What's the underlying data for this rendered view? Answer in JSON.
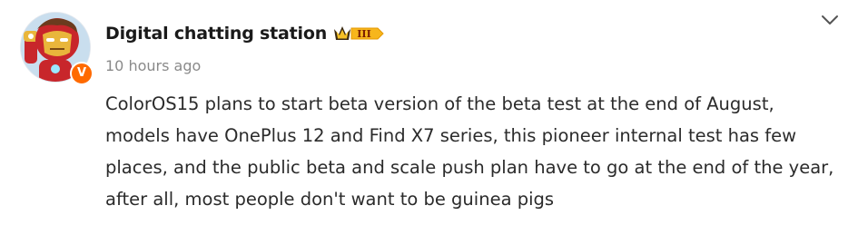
{
  "post": {
    "author": {
      "name": "Digital chatting station",
      "level_badge": "III",
      "verified_mark": "V",
      "avatar_icon": "iron-man-avatar"
    },
    "timestamp": "10 hours ago",
    "content_lines": [
      "ColorOS15 plans to start beta version of the beta test at the end of August,",
      "models have OnePlus 12 and Find X7 series, this pioneer internal test has few",
      "places, and the public beta and scale push plan have to go at the end of the year,",
      "after all, most people don't want to be guinea pigs"
    ],
    "menu_icon": "chevron-down-icon"
  },
  "colors": {
    "accent_orange": "#ff6a00",
    "badge_gold": "#f5b300",
    "text_primary": "#1a1a1a",
    "text_body": "#2b2b2b",
    "text_muted": "#8a8a8a"
  }
}
